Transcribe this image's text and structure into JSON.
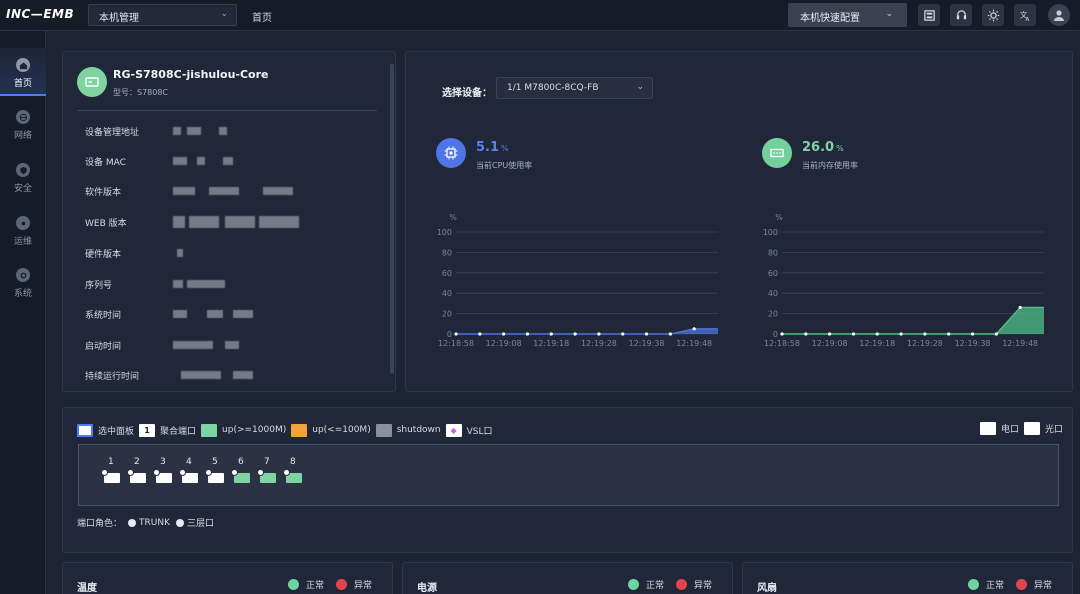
{
  "app": {
    "logo": "INC—EMB",
    "mode": "本机管理",
    "breadcrumb": "首页",
    "quick_config": "本机快速配置"
  },
  "toolbar_icons": [
    "save-icon",
    "support-icon",
    "theme-icon",
    "language-icon"
  ],
  "sidebar": {
    "items": [
      {
        "label": "首页",
        "icon": "home-icon",
        "active": true
      },
      {
        "label": "网络",
        "icon": "globe-icon",
        "active": false
      },
      {
        "label": "安全",
        "icon": "shield-icon",
        "active": false
      },
      {
        "label": "运维",
        "icon": "maintenance-icon",
        "active": false
      },
      {
        "label": "系统",
        "icon": "system-icon",
        "active": false
      }
    ]
  },
  "device": {
    "name": "RG-S7808C-jishulou-Core",
    "model": "型号：S7808C",
    "fields": [
      {
        "label": "设备管理地址"
      },
      {
        "label": "设备 MAC"
      },
      {
        "label": "软件版本"
      },
      {
        "label": "WEB 版本"
      },
      {
        "label": "硬件版本"
      },
      {
        "label": "序列号"
      },
      {
        "label": "系统时间"
      },
      {
        "label": "启动时间"
      },
      {
        "label": "持续运行时间"
      }
    ]
  },
  "monitor": {
    "select_label": "选择设备：",
    "select_value": "1/1 M7800C-8CQ-FB",
    "cpu": {
      "value": "5.1",
      "unit": "%",
      "label": "当前CPU使用率"
    },
    "memory": {
      "value": "26.0",
      "unit": "%",
      "label": "当前内存使用率"
    }
  },
  "chart_data": [
    {
      "type": "area",
      "ylabel": "%",
      "ylim": [
        0,
        100
      ],
      "yticks": [
        0,
        20,
        40,
        60,
        80,
        100
      ],
      "categories": [
        "12:18:58",
        "12:19:08",
        "12:19:18",
        "12:19:28",
        "12:19:38",
        "12:19:48"
      ],
      "x": [
        0,
        1,
        2,
        3,
        4,
        5,
        6,
        7,
        8,
        9,
        10,
        11
      ],
      "values": [
        0,
        0,
        0,
        0,
        0,
        0,
        0,
        0,
        0,
        0,
        5.1,
        5.1
      ],
      "color": "#4f74d9",
      "grid": true
    },
    {
      "type": "area",
      "ylabel": "%",
      "ylim": [
        0,
        100
      ],
      "yticks": [
        0,
        20,
        40,
        60,
        80,
        100
      ],
      "categories": [
        "12:18:58",
        "12:19:08",
        "12:19:18",
        "12:19:28",
        "12:19:38",
        "12:19:48"
      ],
      "x": [
        0,
        1,
        2,
        3,
        4,
        5,
        6,
        7,
        8,
        9,
        10,
        11
      ],
      "values": [
        0,
        0,
        0,
        0,
        0,
        0,
        0,
        0,
        0,
        0,
        26,
        26
      ],
      "color": "#4fbf87",
      "grid": true
    }
  ],
  "ports": {
    "legend": [
      {
        "label": "选中面板",
        "color": "#ffffff",
        "border": "#4b7df6"
      },
      {
        "label": "聚合端口",
        "color": "#ffffff",
        "mark": "1"
      },
      {
        "label": "up(>=1000M)",
        "color": "#7fd3a3"
      },
      {
        "label": "up(<=100M)",
        "color": "#f0a33a"
      },
      {
        "label": "shutdown",
        "color": "#8b919c"
      },
      {
        "label": "VSL口",
        "color": "#ffffff",
        "mark": "◆"
      }
    ],
    "legend_right": [
      {
        "label": "电口",
        "color": "#ffffff"
      },
      {
        "label": "光口",
        "color": "#ffffff"
      }
    ],
    "items": [
      {
        "num": "1",
        "state": "down"
      },
      {
        "num": "2",
        "state": "down"
      },
      {
        "num": "3",
        "state": "down"
      },
      {
        "num": "4",
        "state": "down"
      },
      {
        "num": "5",
        "state": "down"
      },
      {
        "num": "6",
        "state": "up"
      },
      {
        "num": "7",
        "state": "up"
      },
      {
        "num": "8",
        "state": "up"
      }
    ],
    "colors": {
      "down": "#ffffff",
      "up": "#7fd3a3"
    },
    "roles_label": "端口角色：",
    "roles": [
      "TRUNK",
      "三层口"
    ]
  },
  "status_panels": [
    {
      "title": "温度",
      "normal": "正常",
      "abnormal": "异常"
    },
    {
      "title": "电源",
      "normal": "正常",
      "abnormal": "异常"
    },
    {
      "title": "风扇",
      "normal": "正常",
      "abnormal": "异常"
    }
  ],
  "status_colors": {
    "normal": "#6fd3a0",
    "abnormal": "#e2444f"
  }
}
